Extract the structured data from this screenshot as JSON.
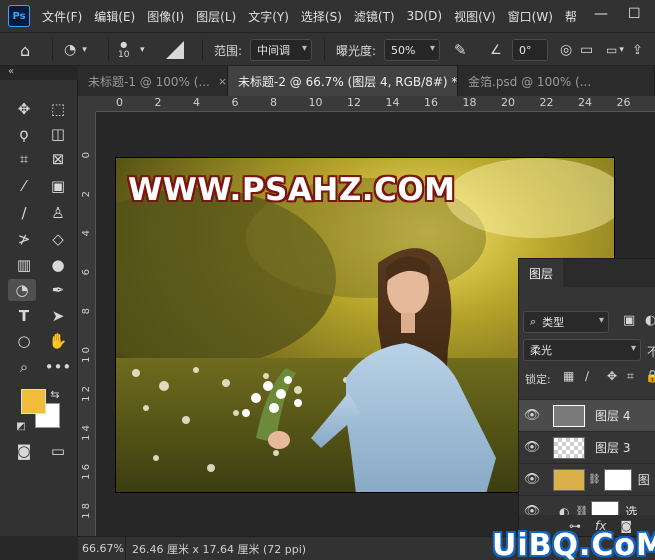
{
  "app": {
    "logo": "Ps"
  },
  "menu": [
    "文件(F)",
    "编辑(E)",
    "图像(I)",
    "图层(L)",
    "文字(Y)",
    "选择(S)",
    "滤镜(T)",
    "3D(D)",
    "视图(V)",
    "窗口(W)",
    "帮"
  ],
  "window_controls": {
    "minimize": "—",
    "maximize": "☐"
  },
  "options": {
    "brush_size": "10",
    "range_label": "范围:",
    "range_value": "中间调",
    "exposure_label": "曝光度:",
    "exposure_value": "50%",
    "angle_value": "0°"
  },
  "tabs": [
    {
      "label": "未标题-1 @ 100% (...",
      "close": "×"
    },
    {
      "label": "未标题-2 @ 66.7% (图层 4, RGB/8#) *",
      "close": "×"
    },
    {
      "label": "金箔.psd @ 100% (...",
      "close": ""
    }
  ],
  "ruler_top": [
    "0",
    "2",
    "4",
    "6",
    "8",
    "10",
    "12",
    "14",
    "16",
    "18",
    "20",
    "22",
    "24",
    "26"
  ],
  "ruler_left": [
    "0",
    "2",
    "4",
    "6",
    "8",
    "1 0",
    "1 2",
    "1 4",
    "1 6",
    "1 8"
  ],
  "canvas": {
    "watermark": "WWW.PSAHZ.COM"
  },
  "status": {
    "zoom": "66.67%",
    "doc_info": "26.46 厘米 x 17.64 厘米 (72 ppi)"
  },
  "layers_panel": {
    "title": "图层",
    "filter_value": "类型",
    "blend_mode": "柔光",
    "opacity_cut": "不",
    "lock_label": "锁定:",
    "layers": [
      {
        "name": "图层 4",
        "selected": true
      },
      {
        "name": "图层 3",
        "selected": false
      },
      {
        "name": "图",
        "selected": false
      },
      {
        "name": "选",
        "selected": false
      }
    ],
    "footer_fx": "fx"
  },
  "colors": {
    "foreground": "#f0bc3a",
    "background": "#ffffff"
  },
  "brand": "UiBQ.CoM"
}
